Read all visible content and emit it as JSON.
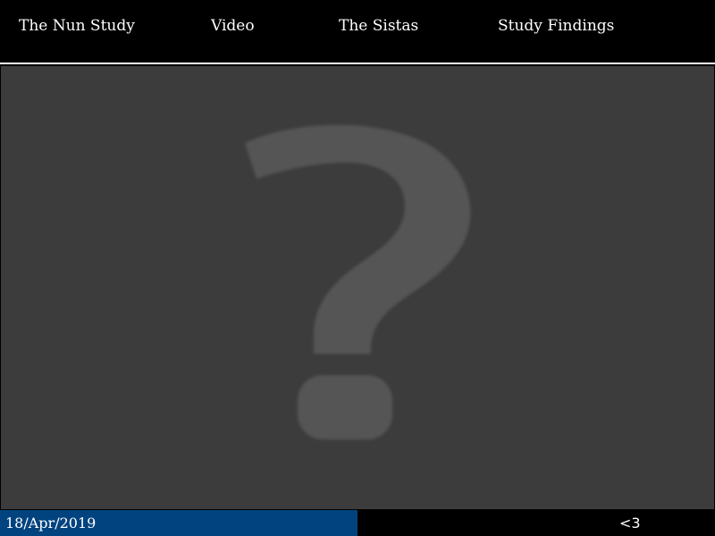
{
  "nav": {
    "items": [
      {
        "label": "The Nun Study"
      },
      {
        "label": "Video"
      },
      {
        "label": "The Sistas"
      },
      {
        "label": "Study Findings"
      }
    ]
  },
  "media": {
    "placeholder_icon": "question-mark-icon",
    "background_color": "#3c3c3c",
    "icon_color": "#545457"
  },
  "footer": {
    "date": "18/Apr/2019",
    "heart": "<3",
    "date_bar_color": "#00437f"
  }
}
